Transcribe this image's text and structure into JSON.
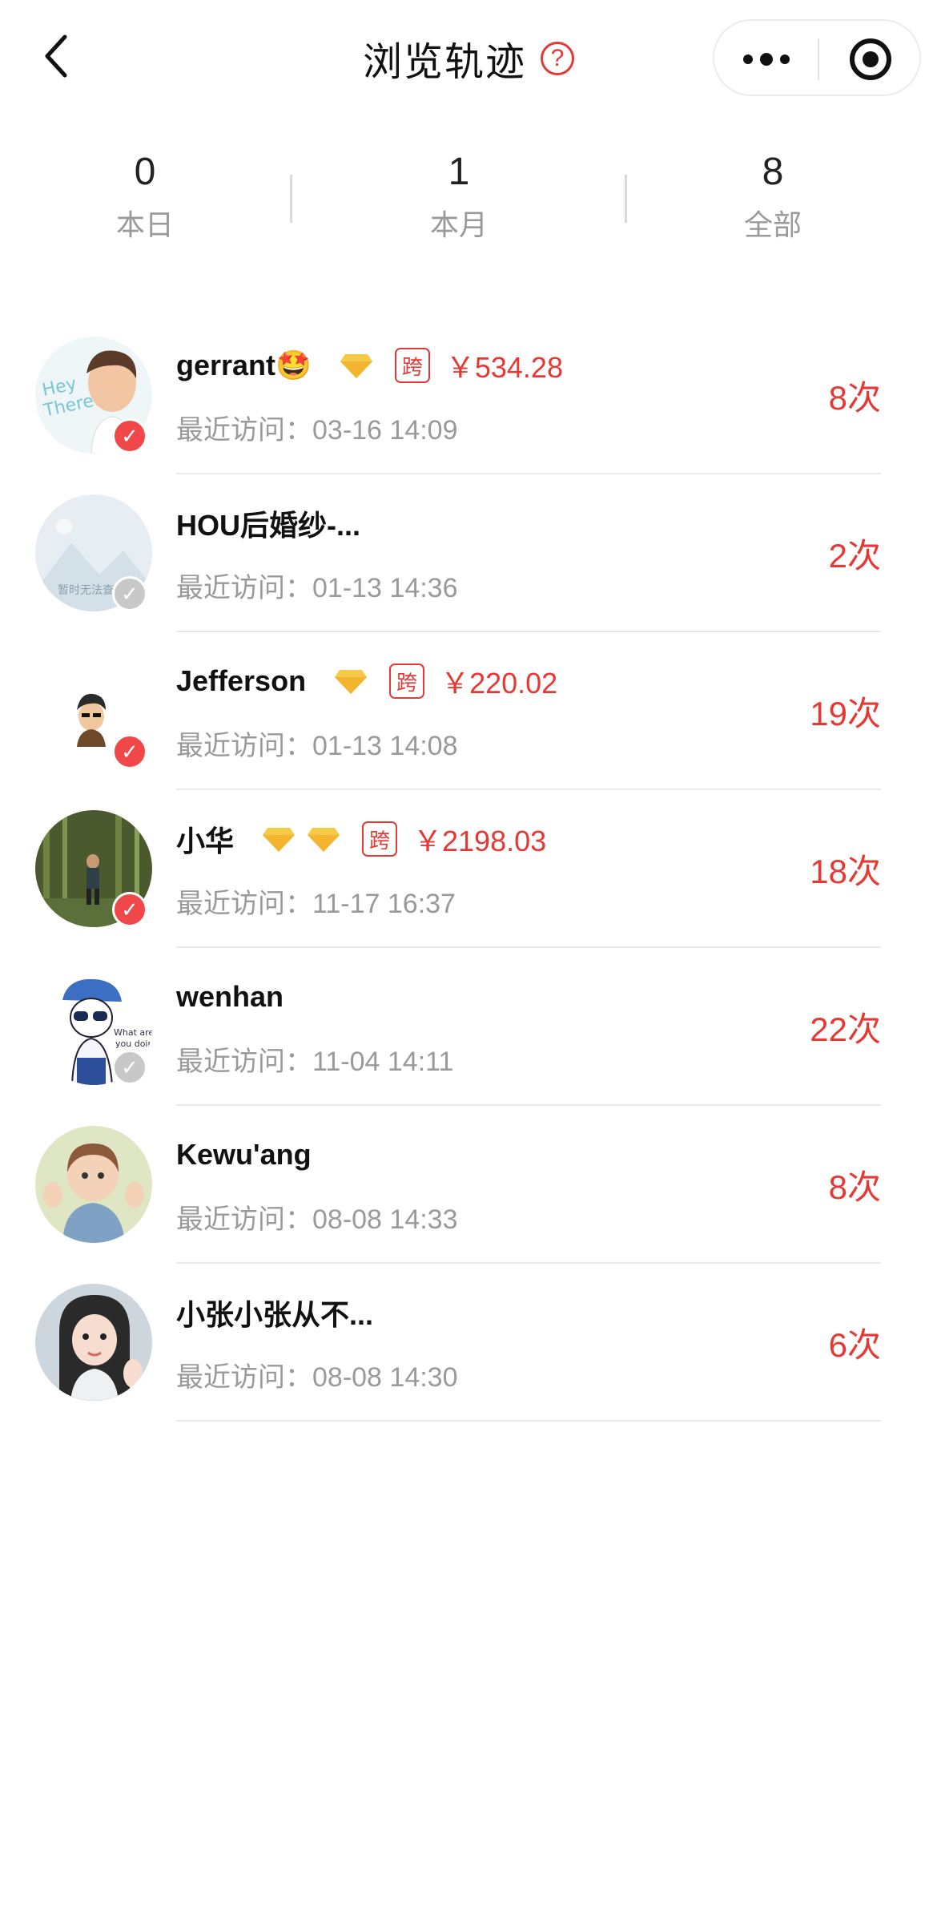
{
  "nav": {
    "title": "浏览轨迹",
    "help_symbol": "?",
    "back_icon": "chevron-left-icon",
    "more_icon": "more-dots-icon",
    "close_icon": "target-icon"
  },
  "stats": [
    {
      "value": "0",
      "label": "本日"
    },
    {
      "value": "1",
      "label": "本月"
    },
    {
      "value": "8",
      "label": "全部"
    }
  ],
  "colors": {
    "accent": "#e53935",
    "muted_text": "#9a9a9a",
    "gem": "#f7c948"
  },
  "visitors": [
    {
      "name": "gerrant🤩",
      "gems": 1,
      "cross_tag": "跨",
      "amount": "￥534.28",
      "visit_label": "最近访问：",
      "visit_time": "03-16 14:09",
      "count": "8次",
      "verified": true
    },
    {
      "name": "HOU后婚纱-...",
      "gems": 0,
      "cross_tag": "",
      "amount": "",
      "visit_label": "最近访问：",
      "visit_time": "01-13 14:36",
      "count": "2次",
      "verified": false
    },
    {
      "name": "Jefferson",
      "gems": 1,
      "cross_tag": "跨",
      "amount": "￥220.02",
      "visit_label": "最近访问：",
      "visit_time": "01-13 14:08",
      "count": "19次",
      "verified": true
    },
    {
      "name": "小华",
      "gems": 2,
      "cross_tag": "跨",
      "amount": "￥2198.03",
      "visit_label": "最近访问：",
      "visit_time": "11-17 16:37",
      "count": "18次",
      "verified": true
    },
    {
      "name": "wenhan",
      "gems": 0,
      "cross_tag": "",
      "amount": "",
      "visit_label": "最近访问：",
      "visit_time": "11-04 14:11",
      "count": "22次",
      "verified": false
    },
    {
      "name": "Kewu'ang",
      "gems": 0,
      "cross_tag": "",
      "amount": "",
      "visit_label": "最近访问：",
      "visit_time": "08-08 14:33",
      "count": "8次",
      "verified": null
    },
    {
      "name": "小张小张从不...",
      "gems": 0,
      "cross_tag": "",
      "amount": "",
      "visit_label": "最近访问：",
      "visit_time": "08-08 14:30",
      "count": "6次",
      "verified": null
    }
  ],
  "avatar_placeholder_text": "暂时无法查"
}
